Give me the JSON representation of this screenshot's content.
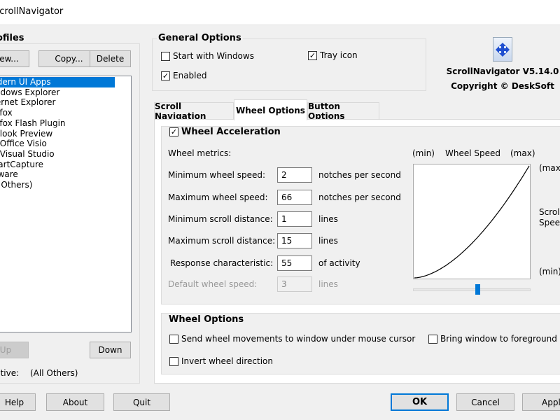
{
  "window": {
    "title": "ScrollNavigator"
  },
  "profiles": {
    "title": "Profiles",
    "new_label": "New...",
    "copy_label": "Copy...",
    "delete_label": "Delete",
    "items": [
      "Modern UI Apps",
      "Windows Explorer",
      "Internet Explorer",
      "Firefox",
      "Firefox Flash Plugin",
      "Outlook Preview",
      "MS Office Visio",
      "MS Visual Studio",
      "SmartCapture",
      "VMware",
      "(All Others)"
    ],
    "selected_index": 0,
    "up_label": "Up",
    "down_label": "Down",
    "active_label": "Active:",
    "active_value": "(All Others)"
  },
  "general": {
    "title": "General Options",
    "start_with_windows": {
      "label": "Start with Windows",
      "checked": false
    },
    "tray_icon": {
      "label": "Tray icon",
      "checked": true
    },
    "enabled": {
      "label": "Enabled",
      "checked": true
    }
  },
  "about": {
    "product": "ScrollNavigator V5.14.0",
    "copyright": "Copyright © DeskSoft",
    "icon": "move-arrows-icon"
  },
  "tabs": [
    {
      "label": "Scroll Navigation"
    },
    {
      "label": "Wheel Options",
      "selected": true
    },
    {
      "label": "Button Options"
    }
  ],
  "accel": {
    "title": "Wheel Acceleration",
    "checked": true,
    "metrics_label": "Wheel metrics:",
    "rows": [
      {
        "label": "Minimum wheel speed:",
        "value": "2",
        "unit": "notches per second"
      },
      {
        "label": "Maximum wheel speed:",
        "value": "66",
        "unit": "notches per second"
      },
      {
        "label": "Minimum scroll distance:",
        "value": "1",
        "unit": "lines"
      },
      {
        "label": "Maximum scroll distance:",
        "value": "15",
        "unit": "lines"
      },
      {
        "label": "Response characteristic:",
        "value": "55",
        "unit": "of activity"
      },
      {
        "label": "Default wheel speed:",
        "value": "3",
        "unit": "lines",
        "disabled": true
      }
    ],
    "graph": {
      "x_min": "(min)",
      "x_title": "Wheel Speed",
      "x_max": "(max)",
      "y_max": "(max)",
      "y_title_1": "Scroll",
      "y_title_2": "Speed",
      "y_min": "(min)"
    },
    "slider_fraction": 0.55
  },
  "wheel_options": {
    "title": "Wheel Options",
    "send_under_cursor": {
      "label": "Send wheel movements to window under mouse cursor",
      "checked": false
    },
    "bring_foreground": {
      "label": "Bring window to foreground",
      "checked": false
    },
    "invert": {
      "label": "Invert wheel direction",
      "checked": false
    }
  },
  "footer": {
    "help": "Help",
    "about": "About",
    "quit": "Quit",
    "ok": "OK",
    "cancel": "Cancel",
    "apply": "Apply"
  }
}
